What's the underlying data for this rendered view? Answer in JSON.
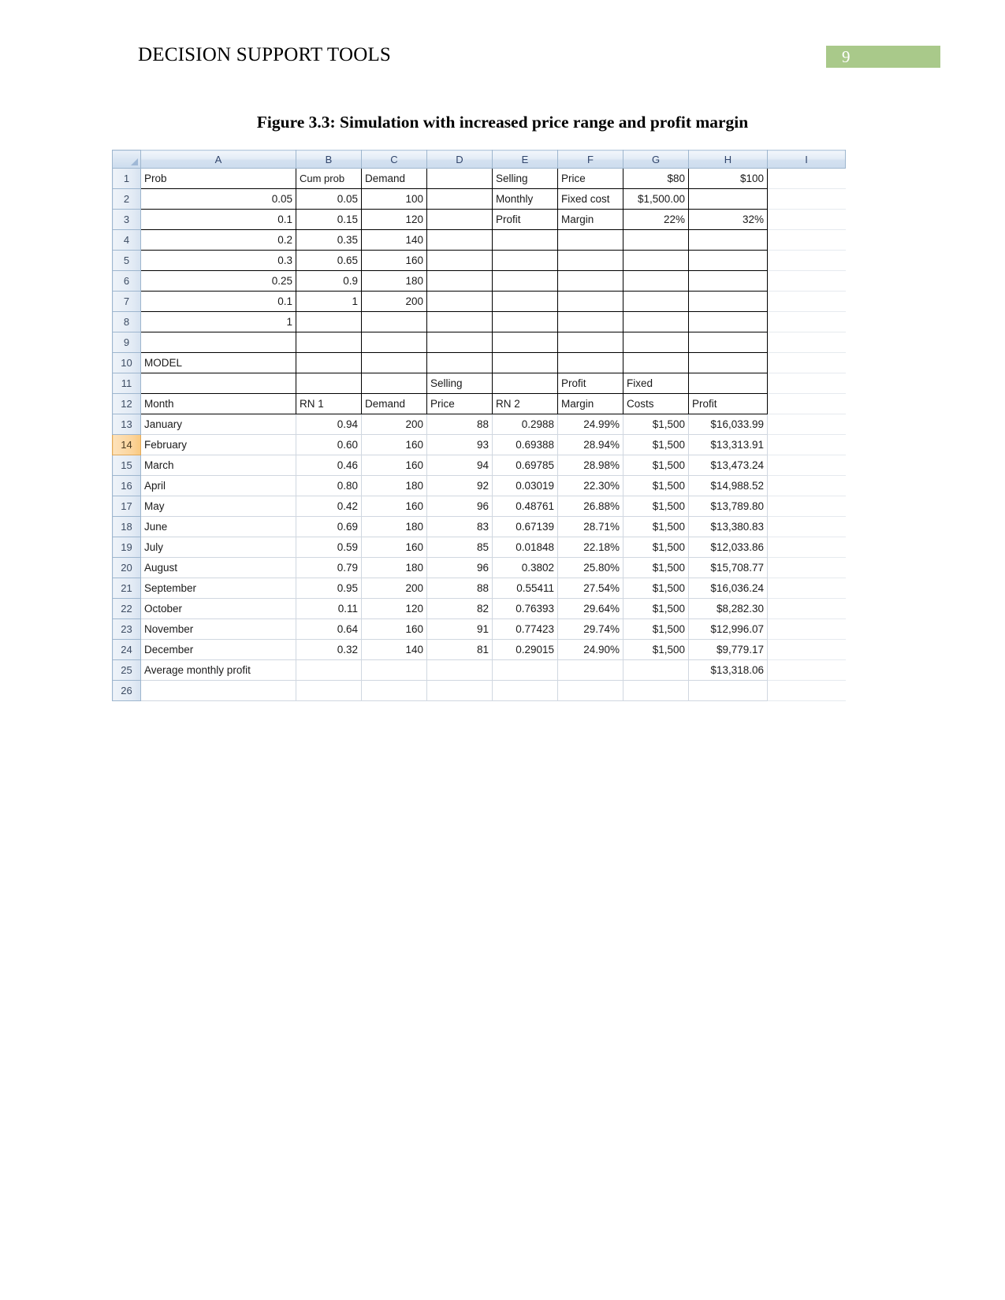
{
  "header": {
    "document_title": "DECISION SUPPORT TOOLS",
    "page_number": "9",
    "badge_color": "#A9C98A"
  },
  "figure": {
    "caption": "Figure 3.3: Simulation with increased price range and profit margin"
  },
  "spreadsheet": {
    "column_letters": [
      "A",
      "B",
      "C",
      "D",
      "E",
      "F",
      "G",
      "H",
      "I"
    ],
    "selected_row_header": "14",
    "selection_color": "#FCD49A",
    "row_numbers": [
      "1",
      "2",
      "3",
      "4",
      "5",
      "6",
      "7",
      "8",
      "9",
      "10",
      "11",
      "12",
      "13",
      "14",
      "15",
      "16",
      "17",
      "18",
      "19",
      "20",
      "21",
      "22",
      "23",
      "24",
      "25",
      "26"
    ],
    "rows": {
      "r1": {
        "A": "Prob",
        "B": "Cum prob",
        "C": "Demand",
        "D": "",
        "E": "Selling",
        "F": "Price",
        "G": "$80",
        "H": "$100"
      },
      "r2": {
        "A": "0.05",
        "B": "0.05",
        "C": "100",
        "D": "",
        "E": "Monthly",
        "F": "Fixed cost",
        "G": "$1,500.00",
        "H": ""
      },
      "r3": {
        "A": "0.1",
        "B": "0.15",
        "C": "120",
        "D": "",
        "E": "Profit",
        "F": "Margin",
        "G": "22%",
        "H": "32%"
      },
      "r4": {
        "A": "0.2",
        "B": "0.35",
        "C": "140",
        "D": "",
        "E": "",
        "F": "",
        "G": "",
        "H": ""
      },
      "r5": {
        "A": "0.3",
        "B": "0.65",
        "C": "160",
        "D": "",
        "E": "",
        "F": "",
        "G": "",
        "H": ""
      },
      "r6": {
        "A": "0.25",
        "B": "0.9",
        "C": "180",
        "D": "",
        "E": "",
        "F": "",
        "G": "",
        "H": ""
      },
      "r7": {
        "A": "0.1",
        "B": "1",
        "C": "200",
        "D": "",
        "E": "",
        "F": "",
        "G": "",
        "H": ""
      },
      "r8": {
        "A": "1",
        "B": "",
        "C": "",
        "D": "",
        "E": "",
        "F": "",
        "G": "",
        "H": ""
      },
      "r9": {
        "A": "",
        "B": "",
        "C": "",
        "D": "",
        "E": "",
        "F": "",
        "G": "",
        "H": ""
      },
      "r10": {
        "A": "MODEL",
        "B": "",
        "C": "",
        "D": "",
        "E": "",
        "F": "",
        "G": "",
        "H": ""
      },
      "r11": {
        "A": "",
        "B": "",
        "C": "",
        "D": "Selling",
        "E": "",
        "F": "Profit",
        "G": "Fixed",
        "H": ""
      },
      "r12": {
        "A": "Month",
        "B": "RN 1",
        "C": "Demand",
        "D": "Price",
        "E": "RN 2",
        "F": "Margin",
        "G": "Costs",
        "H": "Profit"
      },
      "r13": {
        "A": "January",
        "B": "0.94",
        "C": "200",
        "D": "88",
        "E": "0.2988",
        "F": "24.99%",
        "G": "$1,500",
        "H": "$16,033.99"
      },
      "r14": {
        "A": "February",
        "B": "0.60",
        "C": "160",
        "D": "93",
        "E": "0.69388",
        "F": "28.94%",
        "G": "$1,500",
        "H": "$13,313.91"
      },
      "r15": {
        "A": "March",
        "B": "0.46",
        "C": "160",
        "D": "94",
        "E": "0.69785",
        "F": "28.98%",
        "G": "$1,500",
        "H": "$13,473.24"
      },
      "r16": {
        "A": "April",
        "B": "0.80",
        "C": "180",
        "D": "92",
        "E": "0.03019",
        "F": "22.30%",
        "G": "$1,500",
        "H": "$14,988.52"
      },
      "r17": {
        "A": "May",
        "B": "0.42",
        "C": "160",
        "D": "96",
        "E": "0.48761",
        "F": "26.88%",
        "G": "$1,500",
        "H": "$13,789.80"
      },
      "r18": {
        "A": "June",
        "B": "0.69",
        "C": "180",
        "D": "83",
        "E": "0.67139",
        "F": "28.71%",
        "G": "$1,500",
        "H": "$13,380.83"
      },
      "r19": {
        "A": "July",
        "B": "0.59",
        "C": "160",
        "D": "85",
        "E": "0.01848",
        "F": "22.18%",
        "G": "$1,500",
        "H": "$12,033.86"
      },
      "r20": {
        "A": "August",
        "B": "0.79",
        "C": "180",
        "D": "96",
        "E": "0.3802",
        "F": "25.80%",
        "G": "$1,500",
        "H": "$15,708.77"
      },
      "r21": {
        "A": "September",
        "B": "0.95",
        "C": "200",
        "D": "88",
        "E": "0.55411",
        "F": "27.54%",
        "G": "$1,500",
        "H": "$16,036.24"
      },
      "r22": {
        "A": "October",
        "B": "0.11",
        "C": "120",
        "D": "82",
        "E": "0.76393",
        "F": "29.64%",
        "G": "$1,500",
        "H": "$8,282.30"
      },
      "r23": {
        "A": "November",
        "B": "0.64",
        "C": "160",
        "D": "91",
        "E": "0.77423",
        "F": "29.74%",
        "G": "$1,500",
        "H": "$12,996.07"
      },
      "r24": {
        "A": "December",
        "B": "0.32",
        "C": "140",
        "D": "81",
        "E": "0.29015",
        "F": "24.90%",
        "G": "$1,500",
        "H": "$9,779.17"
      },
      "r25": {
        "A": "Average monthly profit",
        "B": "",
        "C": "",
        "D": "",
        "E": "",
        "F": "",
        "G": "",
        "H": "$13,318.06"
      },
      "r26": {
        "A": "",
        "B": "",
        "C": "",
        "D": "",
        "E": "",
        "F": "",
        "G": "",
        "H": ""
      }
    }
  }
}
